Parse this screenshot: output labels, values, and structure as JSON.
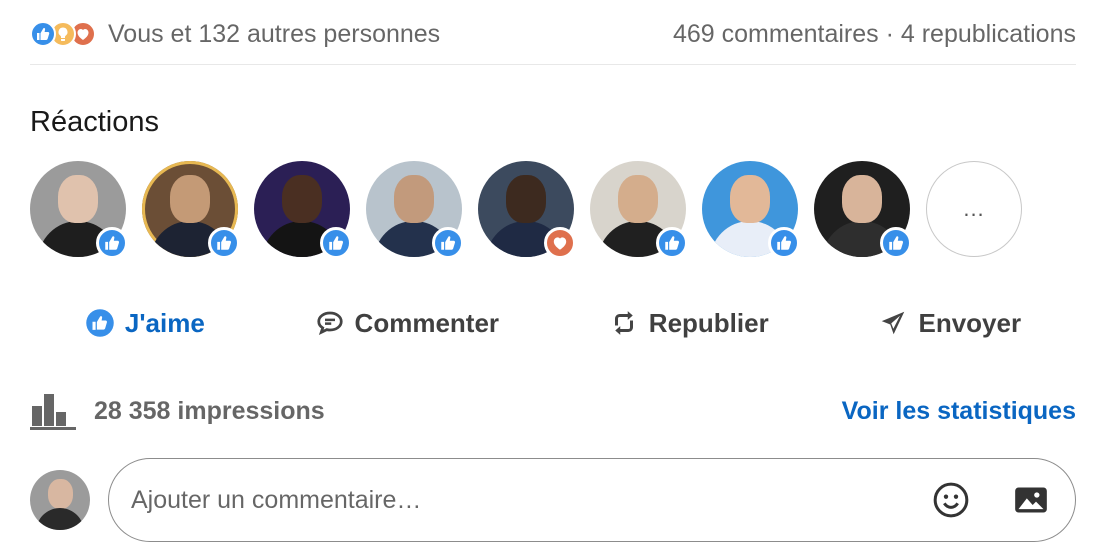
{
  "social": {
    "reactions_text": "Vous et 132 autres personnes",
    "comments_text": "469 commentaires",
    "separator": " · ",
    "reposts_text": "4 republications",
    "reaction_icons": [
      "like-icon",
      "insightful-icon",
      "love-icon"
    ]
  },
  "reactions": {
    "title": "Réactions",
    "people": [
      {
        "reaction": "like",
        "bg": "#9b9b9b",
        "skin": "#e0c2ad",
        "shirt": "#1e1e1e"
      },
      {
        "reaction": "like",
        "bg": "#6b4e36",
        "skin": "#c49a76",
        "shirt": "#1d2333",
        "ring": true
      },
      {
        "reaction": "like",
        "bg": "#2b1f55",
        "skin": "#4a2f22",
        "shirt": "#141414"
      },
      {
        "reaction": "like",
        "bg": "#b8c3cc",
        "skin": "#c29a7c",
        "shirt": "#23314c"
      },
      {
        "reaction": "love",
        "bg": "#3c4a5e",
        "skin": "#3d2a1f",
        "shirt": "#1f2a44"
      },
      {
        "reaction": "like",
        "bg": "#d8d4cc",
        "skin": "#d4ad8c",
        "shirt": "#202020"
      },
      {
        "reaction": "like",
        "bg": "#3f96dc",
        "skin": "#e2b898",
        "shirt": "#e8eef8"
      },
      {
        "reaction": "like",
        "bg": "#1f1f1f",
        "skin": "#d8b49a",
        "shirt": "#2e2e2e"
      }
    ],
    "more_label": "..."
  },
  "actions": [
    {
      "key": "like",
      "label": "J'aime",
      "icon": "thumbs-up-icon"
    },
    {
      "key": "comment",
      "label": "Commenter",
      "icon": "comment-icon"
    },
    {
      "key": "repost",
      "label": "Republier",
      "icon": "repost-icon"
    },
    {
      "key": "send",
      "label": "Envoyer",
      "icon": "send-icon"
    }
  ],
  "impressions": {
    "count_text": "28 358 impressions",
    "link_label": "Voir les statistiques",
    "icon": "bar-chart-icon"
  },
  "comment": {
    "placeholder": "Ajouter un commentaire…",
    "value": "",
    "icons": [
      "emoji-icon",
      "image-icon"
    ]
  },
  "colors": {
    "accent": "#0a66c2",
    "like": "#378fe9",
    "love": "#df704d",
    "insightful": "#f5bb5c"
  }
}
